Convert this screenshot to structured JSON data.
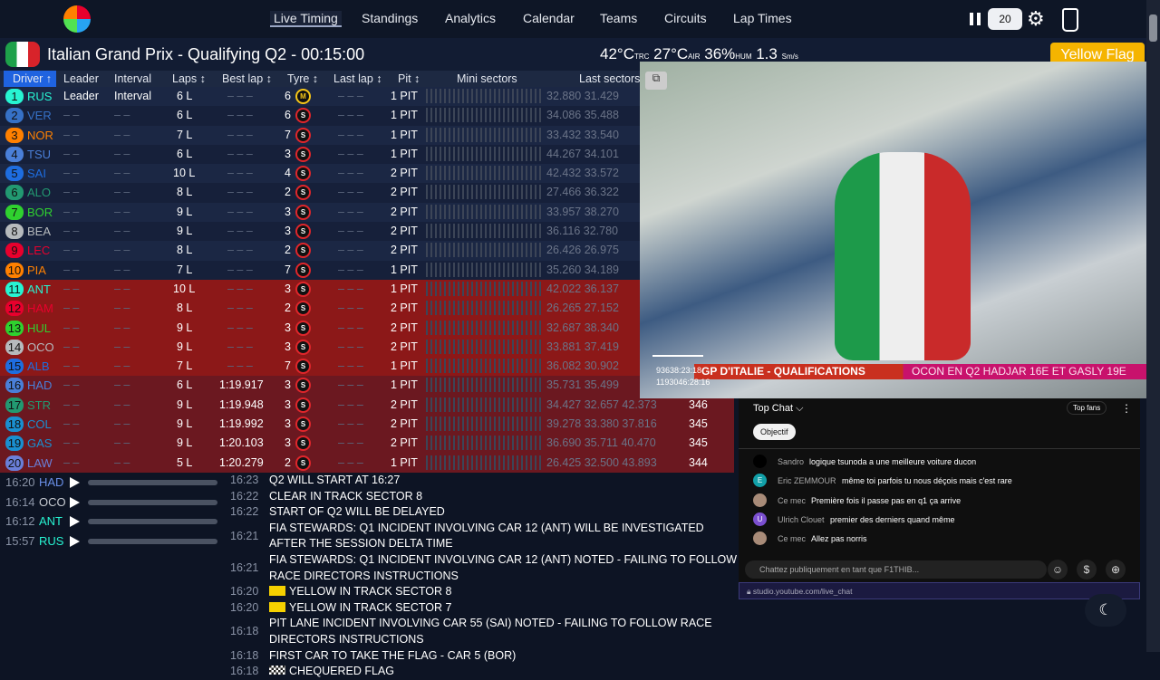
{
  "nav": {
    "items": [
      "Live Timing",
      "Standings",
      "Analytics",
      "Calendar",
      "Teams",
      "Circuits",
      "Lap Times"
    ],
    "speed": "20"
  },
  "session": {
    "title": "Italian Grand Prix - Qualifying Q2 - 00:15:00",
    "track_temp": "42°C",
    "track_lbl": "TRC",
    "air_temp": "27°C",
    "air_lbl": "AIR",
    "humidity": "36%",
    "hum_lbl": "HUM",
    "wind": "1.3",
    "wind_dir": "S",
    "wind_unit": "m/s",
    "flag": "Yellow Flag"
  },
  "columns": [
    "Driver ↑",
    "Leader",
    "Interval",
    "Laps ↕",
    "Best lap ↕",
    "Tyre ↕",
    "Last lap ↕",
    "Pit ↕",
    "Mini sectors",
    "Last sectors"
  ],
  "drivers": [
    {
      "pos": "1",
      "tla": "RUS",
      "color": "#27f4d2",
      "leader": "Leader",
      "interval": "Interval",
      "laps": "6 L",
      "best": "– – –",
      "tyre_age": "6",
      "tyre": "M",
      "tyre_color": "#f5c518",
      "last": "– – –",
      "pit": "1 PIT",
      "sectors": "32.880  31.429",
      "speed": ""
    },
    {
      "pos": "2",
      "tla": "VER",
      "color": "#3671c6",
      "leader": "– –",
      "interval": "– –",
      "laps": "6 L",
      "best": "– – –",
      "tyre_age": "6",
      "tyre": "S",
      "tyre_color": "#e0262b",
      "last": "– – –",
      "pit": "1 PIT",
      "sectors": "34.086  35.488",
      "speed": ""
    },
    {
      "pos": "3",
      "tla": "NOR",
      "color": "#ff8000",
      "leader": "– –",
      "interval": "– –",
      "laps": "7 L",
      "best": "– – –",
      "tyre_age": "7",
      "tyre": "S",
      "tyre_color": "#e0262b",
      "last": "– – –",
      "pit": "1 PIT",
      "sectors": "33.432  33.540",
      "speed": ""
    },
    {
      "pos": "4",
      "tla": "TSU",
      "color": "#4a7fd8",
      "leader": "– –",
      "interval": "– –",
      "laps": "6 L",
      "best": "– – –",
      "tyre_age": "3",
      "tyre": "S",
      "tyre_color": "#e0262b",
      "last": "– – –",
      "pit": "1 PIT",
      "sectors": "44.267  34.101",
      "speed": ""
    },
    {
      "pos": "5",
      "tla": "SAI",
      "color": "#1e6de0",
      "leader": "– –",
      "interval": "– –",
      "laps": "10 L",
      "best": "– – –",
      "tyre_age": "4",
      "tyre": "S",
      "tyre_color": "#e0262b",
      "last": "– – –",
      "pit": "2 PIT",
      "sectors": "42.432  33.572",
      "speed": ""
    },
    {
      "pos": "6",
      "tla": "ALO",
      "color": "#229971",
      "leader": "– –",
      "interval": "– –",
      "laps": "8 L",
      "best": "– – –",
      "tyre_age": "2",
      "tyre": "S",
      "tyre_color": "#e0262b",
      "last": "– – –",
      "pit": "2 PIT",
      "sectors": "27.466  36.322",
      "speed": ""
    },
    {
      "pos": "7",
      "tla": "BOR",
      "color": "#2fd12f",
      "leader": "– –",
      "interval": "– –",
      "laps": "9 L",
      "best": "– – –",
      "tyre_age": "3",
      "tyre": "S",
      "tyre_color": "#e0262b",
      "last": "– – –",
      "pit": "2 PIT",
      "sectors": "33.957  38.270",
      "speed": ""
    },
    {
      "pos": "8",
      "tla": "BEA",
      "color": "#b6babd",
      "leader": "– –",
      "interval": "– –",
      "laps": "9 L",
      "best": "– – –",
      "tyre_age": "3",
      "tyre": "S",
      "tyre_color": "#e0262b",
      "last": "– – –",
      "pit": "2 PIT",
      "sectors": "36.116  32.780",
      "speed": ""
    },
    {
      "pos": "9",
      "tla": "LEC",
      "color": "#e8002d",
      "leader": "– –",
      "interval": "– –",
      "laps": "8 L",
      "best": "– – –",
      "tyre_age": "2",
      "tyre": "S",
      "tyre_color": "#e0262b",
      "last": "– – –",
      "pit": "2 PIT",
      "sectors": "26.426  26.975",
      "speed": ""
    },
    {
      "pos": "10",
      "tla": "PIA",
      "color": "#ff8000",
      "leader": "– –",
      "interval": "– –",
      "laps": "7 L",
      "best": "– – –",
      "tyre_age": "7",
      "tyre": "S",
      "tyre_color": "#e0262b",
      "last": "– – –",
      "pit": "1 PIT",
      "sectors": "35.260  34.189",
      "speed": ""
    },
    {
      "pos": "11",
      "tla": "ANT",
      "color": "#27f4d2",
      "leader": "– –",
      "interval": "– –",
      "laps": "10 L",
      "best": "– – –",
      "tyre_age": "3",
      "tyre": "S",
      "tyre_color": "#e0262b",
      "last": "– – –",
      "pit": "1 PIT",
      "sectors": "42.022  36.137",
      "speed": ""
    },
    {
      "pos": "12",
      "tla": "HAM",
      "color": "#e8002d",
      "leader": "– –",
      "interval": "– –",
      "laps": "8 L",
      "best": "– – –",
      "tyre_age": "2",
      "tyre": "S",
      "tyre_color": "#e0262b",
      "last": "– – –",
      "pit": "2 PIT",
      "sectors": "26.265  27.152",
      "speed": ""
    },
    {
      "pos": "13",
      "tla": "HUL",
      "color": "#2fd12f",
      "leader": "– –",
      "interval": "– –",
      "laps": "9 L",
      "best": "– – –",
      "tyre_age": "3",
      "tyre": "S",
      "tyre_color": "#e0262b",
      "last": "– – –",
      "pit": "2 PIT",
      "sectors": "32.687  38.340",
      "speed": ""
    },
    {
      "pos": "14",
      "tla": "OCO",
      "color": "#b6babd",
      "leader": "– –",
      "interval": "– –",
      "laps": "9 L",
      "best": "– – –",
      "tyre_age": "3",
      "tyre": "S",
      "tyre_color": "#e0262b",
      "last": "– – –",
      "pit": "2 PIT",
      "sectors": "33.881  37.419",
      "speed": ""
    },
    {
      "pos": "15",
      "tla": "ALB",
      "color": "#1e6de0",
      "leader": "– –",
      "interval": "– –",
      "laps": "7 L",
      "best": "– – –",
      "tyre_age": "7",
      "tyre": "S",
      "tyre_color": "#e0262b",
      "last": "– – –",
      "pit": "1 PIT",
      "sectors": "36.082  30.902",
      "speed": ""
    },
    {
      "pos": "16",
      "tla": "HAD",
      "color": "#4a7fd8",
      "leader": "– –",
      "interval": "– –",
      "laps": "6 L",
      "best": "1:19.917",
      "tyre_age": "3",
      "tyre": "S",
      "tyre_color": "#e0262b",
      "last": "– – –",
      "pit": "1 PIT",
      "sectors": "35.731  35.499",
      "speed": ""
    },
    {
      "pos": "17",
      "tla": "STR",
      "color": "#229971",
      "leader": "– –",
      "interval": "– –",
      "laps": "9 L",
      "best": "1:19.948",
      "tyre_age": "3",
      "tyre": "S",
      "tyre_color": "#e0262b",
      "last": "– – –",
      "pit": "2 PIT",
      "sectors": "34.427  32.657  42.373",
      "speed": "346"
    },
    {
      "pos": "18",
      "tla": "COL",
      "color": "#1a8fd0",
      "leader": "– –",
      "interval": "– –",
      "laps": "9 L",
      "best": "1:19.992",
      "tyre_age": "3",
      "tyre": "S",
      "tyre_color": "#e0262b",
      "last": "– – –",
      "pit": "2 PIT",
      "sectors": "39.278  33.380  37.816",
      "speed": "345"
    },
    {
      "pos": "19",
      "tla": "GAS",
      "color": "#1a8fd0",
      "leader": "– –",
      "interval": "– –",
      "laps": "9 L",
      "best": "1:20.103",
      "tyre_age": "3",
      "tyre": "S",
      "tyre_color": "#e0262b",
      "last": "– – –",
      "pit": "2 PIT",
      "sectors": "36.690  35.711  40.470",
      "speed": "345"
    },
    {
      "pos": "20",
      "tla": "LAW",
      "color": "#6a7fd8",
      "leader": "– –",
      "interval": "– –",
      "laps": "5 L",
      "best": "1:20.279",
      "tyre_age": "2",
      "tyre": "S",
      "tyre_color": "#e0262b",
      "last": "– – –",
      "pit": "1 PIT",
      "sectors": "26.425  32.500  43.893",
      "speed": "344"
    }
  ],
  "radio": [
    {
      "time": "16:20",
      "tla": "HAD",
      "color": "#6a8fe8"
    },
    {
      "time": "16:14",
      "tla": "OCO",
      "color": "#c8ccd2"
    },
    {
      "time": "16:12",
      "tla": "ANT",
      "color": "#27f4d2"
    },
    {
      "time": "15:57",
      "tla": "RUS",
      "color": "#27f4d2"
    }
  ],
  "messages": [
    {
      "time": "16:23",
      "text": "Q2 WILL START AT 16:27",
      "flag": ""
    },
    {
      "time": "16:22",
      "text": "CLEAR IN TRACK SECTOR 8",
      "flag": ""
    },
    {
      "time": "16:22",
      "text": "START OF Q2 WILL BE DELAYED",
      "flag": ""
    },
    {
      "time": "16:21",
      "text": "FIA STEWARDS: Q1 INCIDENT INVOLVING CAR 12 (ANT) WILL BE INVESTIGATED AFTER THE SESSION DELTA TIME",
      "flag": ""
    },
    {
      "time": "16:21",
      "text": "FIA STEWARDS: Q1 INCIDENT INVOLVING CAR 12 (ANT) NOTED - FAILING TO FOLLOW RACE DIRECTORS INSTRUCTIONS",
      "flag": ""
    },
    {
      "time": "16:20",
      "text": "YELLOW IN TRACK SECTOR 8",
      "flag": "yellow"
    },
    {
      "time": "16:20",
      "text": "YELLOW IN TRACK SECTOR 7",
      "flag": "yellow"
    },
    {
      "time": "16:18",
      "text": "PIT LANE INCIDENT INVOLVING CAR 55 (SAI) NOTED - FAILING TO FOLLOW RACE DIRECTORS INSTRUCTIONS",
      "flag": ""
    },
    {
      "time": "16:18",
      "text": "FIRST CAR TO TAKE THE FLAG - CAR 5 (BOR)",
      "flag": ""
    },
    {
      "time": "16:18",
      "text": "CHEQUERED FLAG",
      "flag": "chequered"
    }
  ],
  "video": {
    "banner": "GP D'ITALIE - QUALIFICATIONS",
    "ticker": "OCON EN Q2 HADJAR 16E ET GASLY 19E",
    "time1": "93638:23:18",
    "time2": "1193046:28:16"
  },
  "chat": {
    "title": "Top Chat ⌵",
    "top_fans": "Top fans",
    "objective": "Objectif",
    "input_placeholder": "Chattez publiquement en tant que F1THIB...",
    "url": "studio.youtube.com/live_chat",
    "messages": [
      {
        "author": "Sandro",
        "text": "logique tsunoda a une meilleure voiture ducon",
        "avatar": "",
        "avatar_color": "#000"
      },
      {
        "author": "Eric ZEMMOUR",
        "text": "même toi parfois tu nous déçois mais c'est rare",
        "avatar": "E",
        "avatar_color": "#12a0a8"
      },
      {
        "author": "Ce mec",
        "text": "Première fois il passe pas en q1 ça arrive",
        "avatar": "",
        "avatar_color": "#a88b78"
      },
      {
        "author": "Ulrich Clouet",
        "text": "premier des derniers quand même",
        "avatar": "U",
        "avatar_color": "#7b4fd0"
      },
      {
        "author": "Ce mec",
        "text": "Allez pas norris",
        "avatar": "",
        "avatar_color": "#a88b78"
      }
    ]
  }
}
